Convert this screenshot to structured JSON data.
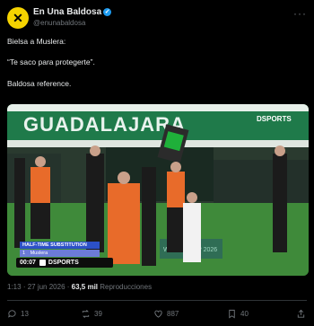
{
  "account": {
    "display_name": "En Una Baldosa",
    "handle": "@enunabaldosa"
  },
  "tweet": {
    "line1": "Bielsa a Muslera:",
    "line2": "“Te saco para protegerte”.",
    "line3": "Baldosa reference."
  },
  "media": {
    "stadium_banner": "GUADALAJARA",
    "broadcaster_logo": "DSPORTS",
    "board_text": "HALF-TIME SUBSTITUTION",
    "player_number": "1",
    "player_name": "Muslera",
    "clock": "00:07",
    "score_logo": "DSPORTS",
    "ad_board": "WORLD CUP 2026"
  },
  "meta": {
    "time": "1:13",
    "date": "27 jun 2026",
    "views": "63,5 mil",
    "views_label": "Reproducciones"
  },
  "actions": {
    "replies": "13",
    "retweets": "39",
    "likes": "887",
    "bookmarks": "40"
  },
  "colors": {
    "background": "#000000",
    "verified": "#1d9bf0",
    "muted": "#71767b"
  }
}
